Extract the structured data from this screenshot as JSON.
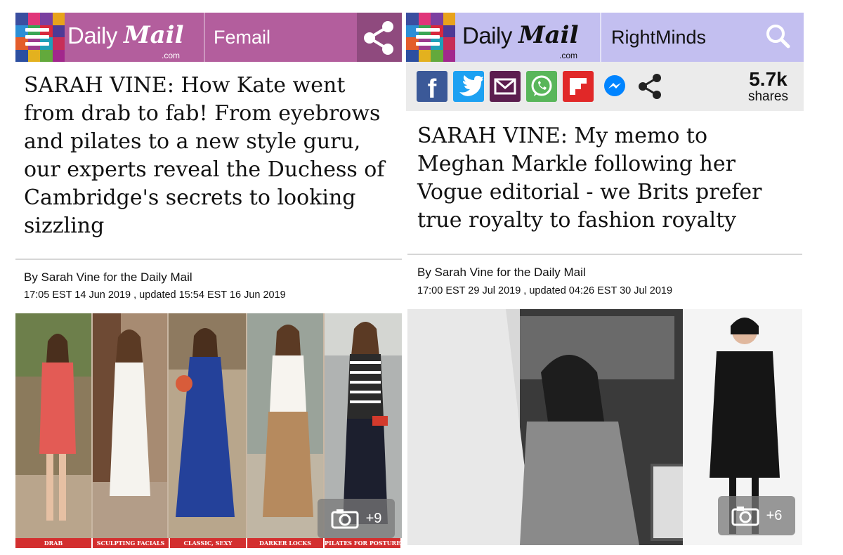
{
  "left": {
    "brand": {
      "daily": "Daily",
      "mail": "Mail",
      "com": ".com"
    },
    "section": "Femail",
    "headline": "SARAH VINE: How Kate went from drab to fab! From eyebrows and pilates to a new style guru, our experts reveal the Duchess of Cambridge's secrets to looking sizzling",
    "byline": "By Sarah Vine for the Daily Mail",
    "dateline": "17:05 EST 14 Jun 2019 , updated 15:54 EST 16 Jun 2019",
    "photo_count": "+9",
    "captions": [
      "DRAB",
      "SCULPTING FACIALS",
      "CLASSIC, SEXY",
      "DARKER LOCKS",
      "PILATES FOR POSTURE"
    ],
    "colors": {
      "header": "#b35e9d",
      "share_box": "#8f4a7e",
      "caption": "#d32f2f"
    }
  },
  "right": {
    "brand": {
      "daily": "Daily",
      "mail": "Mail",
      "com": ".com"
    },
    "section": "RightMinds",
    "share_count": "5.7k",
    "share_label": "shares",
    "share_buttons": [
      "facebook-icon",
      "twitter-icon",
      "email-icon",
      "whatsapp-icon",
      "flipboard-icon",
      "messenger-icon",
      "share-icon"
    ],
    "headline": "SARAH VINE: My memo to Meghan Markle following her Vogue editorial - we Brits prefer true royalty to fashion royalty",
    "byline": "By Sarah Vine for the Daily Mail",
    "dateline": "17:00 EST 29 Jul 2019 , updated 04:26 EST 30 Jul 2019",
    "photo_count": "+6",
    "colors": {
      "header": "#c3bff0",
      "facebook": "#3b5998",
      "twitter": "#1da1f2",
      "email": "#5c1e4f",
      "whatsapp": "#59b65a",
      "flipboard": "#e12828",
      "messenger": "#0084ff"
    }
  }
}
